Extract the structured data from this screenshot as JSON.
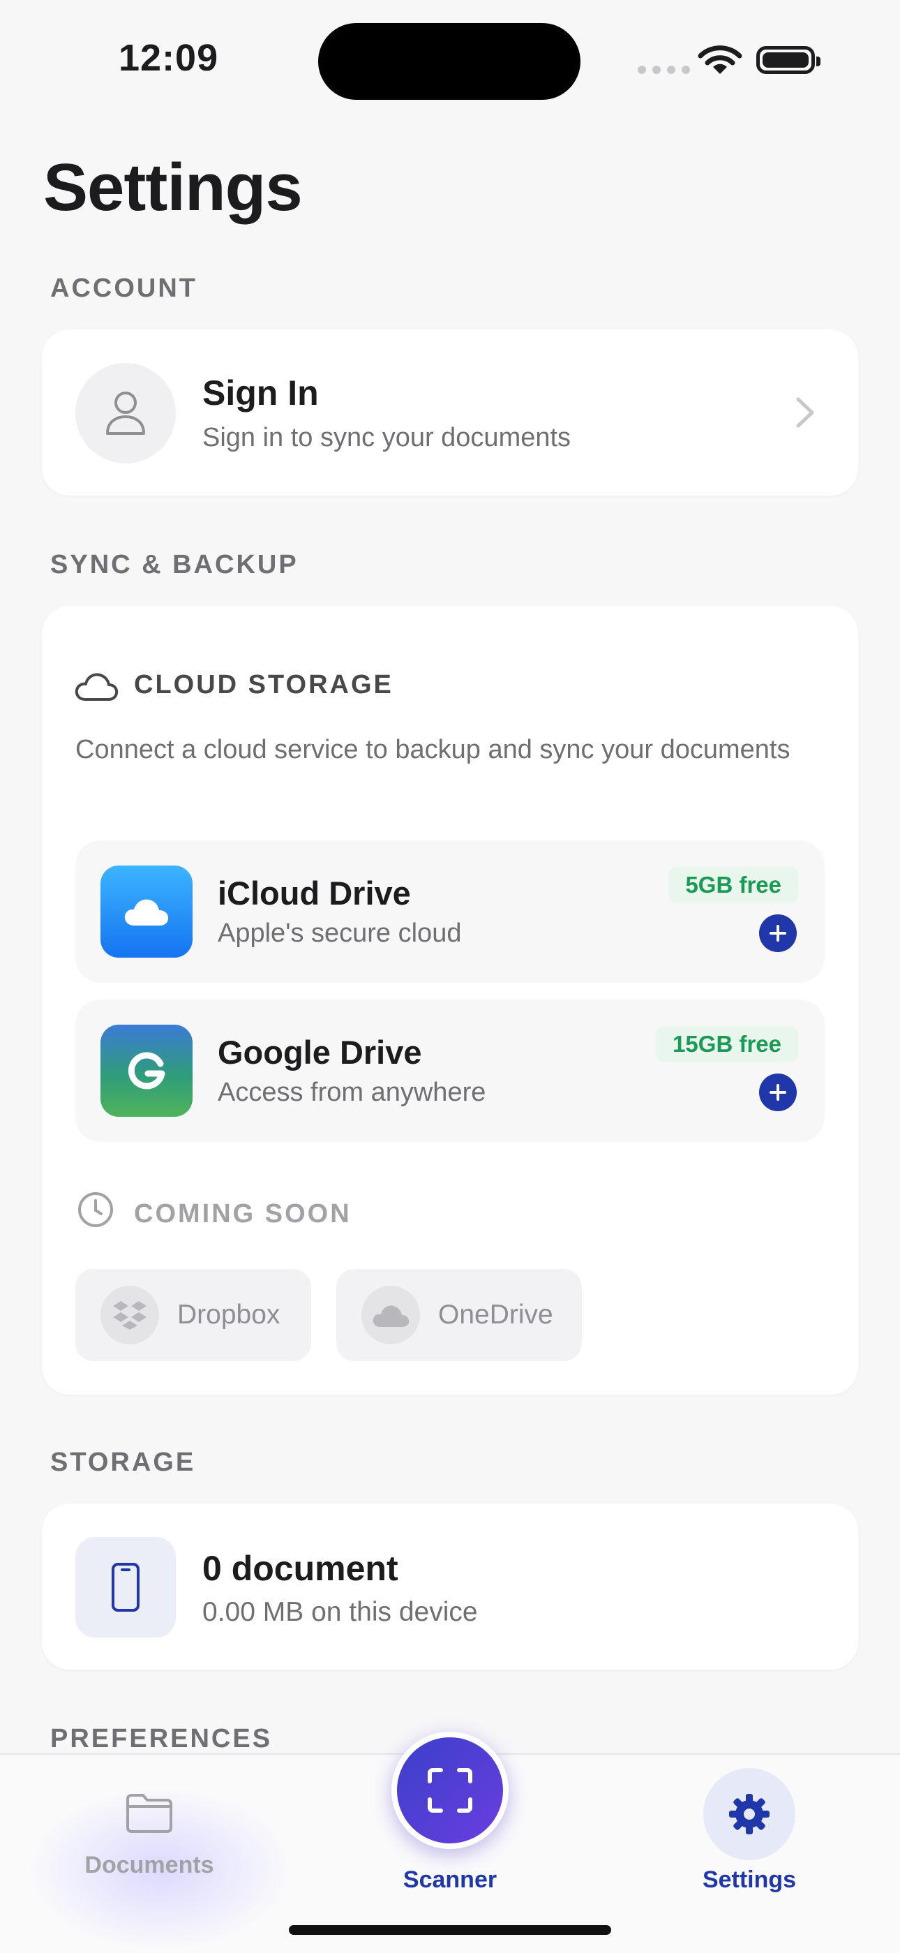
{
  "status_bar": {
    "time": "12:09"
  },
  "page": {
    "title": "Settings"
  },
  "sections": {
    "account": "ACCOUNT",
    "sync": "SYNC & BACKUP",
    "storage": "STORAGE",
    "preferences": "PREFERENCES"
  },
  "account": {
    "title": "Sign In",
    "subtitle": "Sign in to sync your documents"
  },
  "cloud_storage": {
    "label": "CLOUD STORAGE",
    "description": "Connect a cloud service to backup and sync your documents",
    "providers": [
      {
        "name": "iCloud Drive",
        "description": "Apple's secure cloud",
        "badge": "5GB free",
        "icon": "icloud-icon"
      },
      {
        "name": "Google Drive",
        "description": "Access from anywhere",
        "badge": "15GB free",
        "icon": "google-drive-icon"
      }
    ],
    "coming_soon_label": "COMING SOON",
    "coming_soon": [
      {
        "name": "Dropbox",
        "icon": "dropbox-icon"
      },
      {
        "name": "OneDrive",
        "icon": "onedrive-icon"
      }
    ]
  },
  "storage": {
    "title": "0 document",
    "subtitle": "0.00 MB on this device"
  },
  "tabs": [
    {
      "label": "Documents",
      "icon": "folder-icon",
      "active": false
    },
    {
      "label": "Scanner",
      "icon": "scan-icon",
      "active": true
    },
    {
      "label": "Settings",
      "icon": "gear-icon",
      "active": true
    }
  ],
  "colors": {
    "accent": "#1f37a8",
    "badge_text": "#1b9a55",
    "badge_bg": "#e8f6ee",
    "scanner_gradient_start": "#3b3fc9",
    "scanner_gradient_end": "#6a3ee0"
  }
}
